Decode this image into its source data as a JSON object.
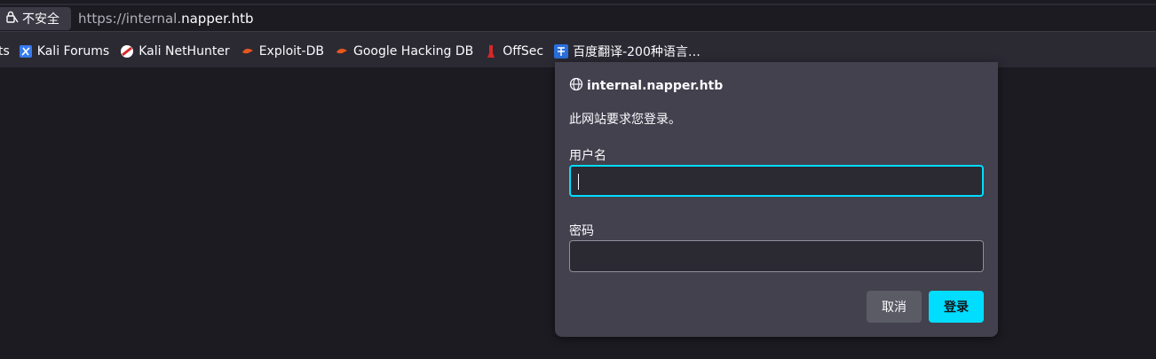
{
  "urlbar": {
    "security_label": "不安全",
    "url_prefix": "https://internal.",
    "url_host": "napper.htb"
  },
  "bookmarks": {
    "cut_item": "ts",
    "items": [
      {
        "label": "Kali Forums",
        "icon": "kali-forums-icon"
      },
      {
        "label": "Kali NetHunter",
        "icon": "kali-nethunter-icon"
      },
      {
        "label": "Exploit-DB",
        "icon": "exploit-db-icon"
      },
      {
        "label": "Google Hacking DB",
        "icon": "google-hacking-db-icon"
      },
      {
        "label": "OffSec",
        "icon": "offsec-icon"
      },
      {
        "label": "百度翻译-200种语言…",
        "icon": "baidu-translate-icon"
      }
    ]
  },
  "dialog": {
    "site": "internal.napper.htb",
    "message": "此网站要求您登录。",
    "username_label": "用户名",
    "username_value": "",
    "password_label": "密码",
    "password_value": "",
    "cancel_label": "取消",
    "login_label": "登录"
  },
  "colors": {
    "accent": "#00ddff",
    "dialog_bg": "#42414d",
    "page_bg": "#1c1b22",
    "toolbar_bg": "#2b2a33"
  }
}
